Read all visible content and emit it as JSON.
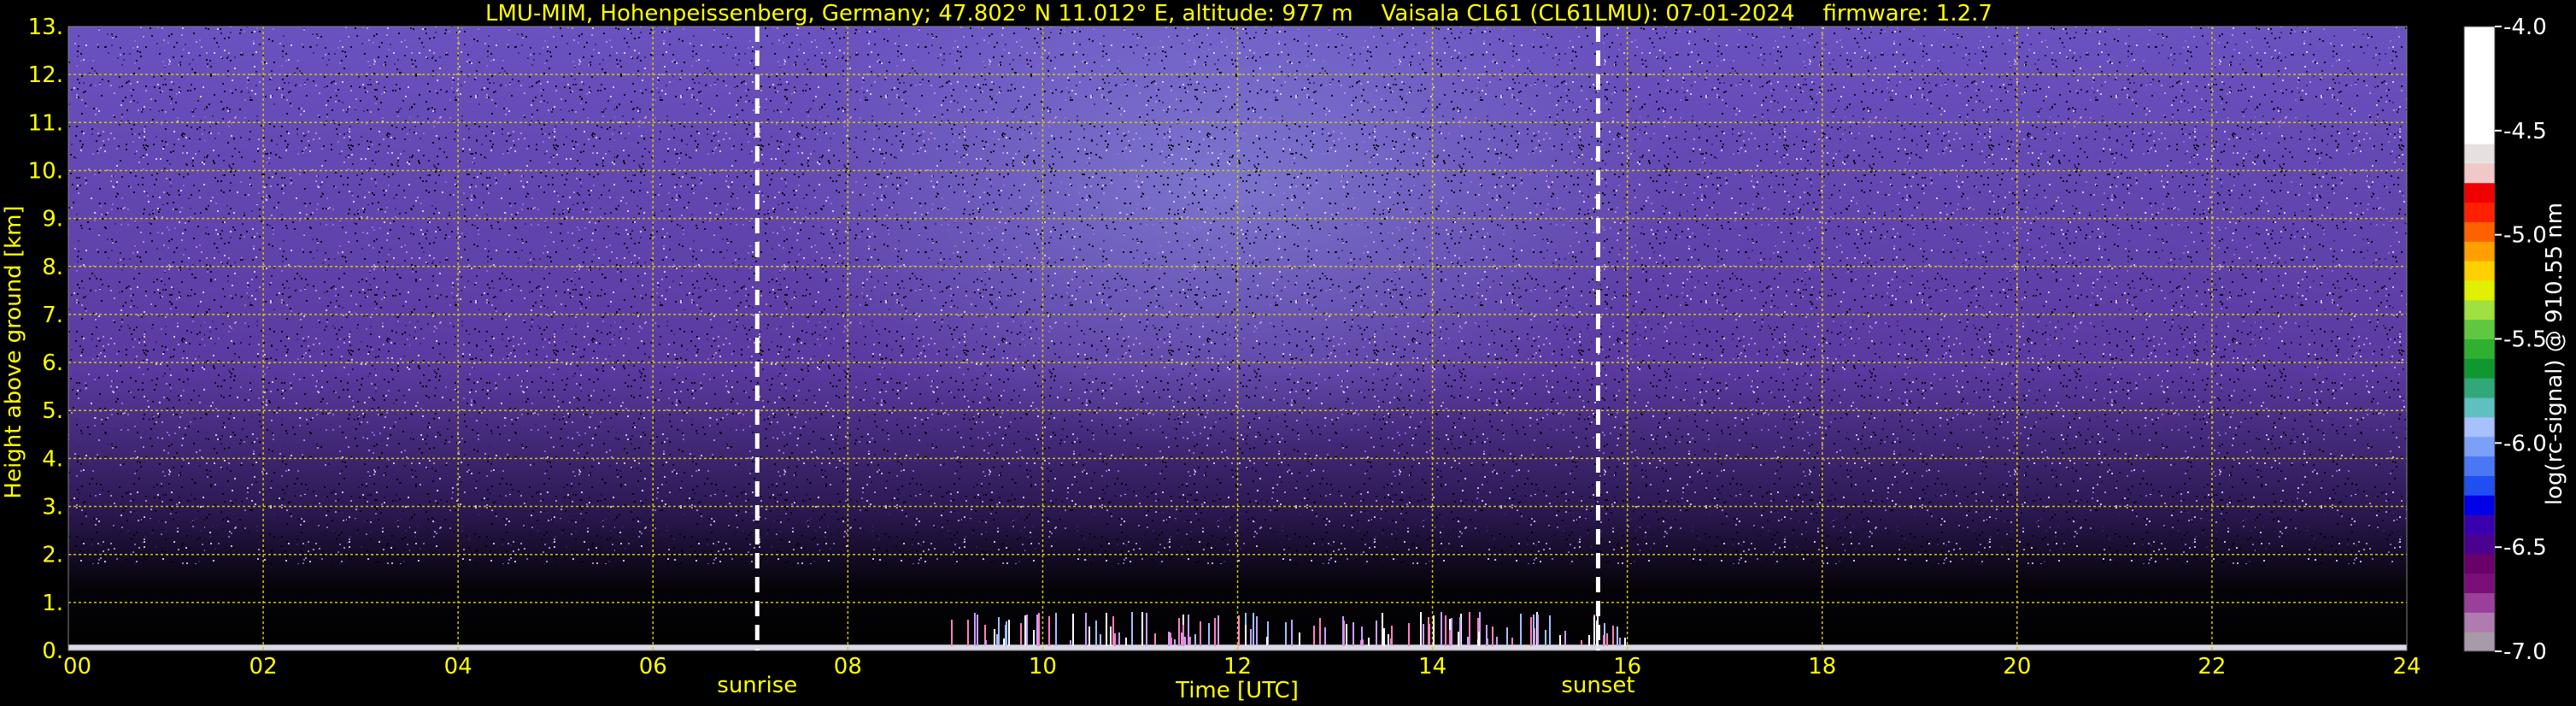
{
  "chart_data": {
    "type": "heatmap",
    "title": "LMU-MIM, Hohenpeissenberg, Germany; 47.802° N 11.012° E, altitude: 977 m    Vaisala CL61 (CL61LMU): 07-01-2024    firmware: 1.2.7",
    "xlabel": "Time [UTC]",
    "ylabel": "Height above ground [km]",
    "xlim": [
      0,
      24
    ],
    "ylim": [
      0,
      13
    ],
    "x_ticks": [
      "00",
      "02",
      "04",
      "06",
      "08",
      "10",
      "12",
      "14",
      "16",
      "18",
      "20",
      "22",
      "24"
    ],
    "y_ticks": [
      "0.",
      "1.",
      "2.",
      "3.",
      "4.",
      "5.",
      "6.",
      "7.",
      "8.",
      "9.",
      "10.",
      "11.",
      "12.",
      "13."
    ],
    "grid": true,
    "markers": [
      {
        "label": "sunrise",
        "x": 7.07
      },
      {
        "label": "sunset",
        "x": 15.7
      }
    ],
    "colorbar": {
      "label": "log(rc-signal) @ 910.55 nm",
      "range": [
        -7.0,
        -4.0
      ],
      "ticks": [
        "-4.0",
        "-4.5",
        "-5.0",
        "-5.5",
        "-6.0",
        "-6.5",
        "-7.0"
      ],
      "colors": [
        "#a89aa8",
        "#b07cb0",
        "#9a3f9a",
        "#7a0f7a",
        "#6a006a",
        "#4b0090",
        "#3a00b0",
        "#0000e8",
        "#1f4ff0",
        "#4a78f5",
        "#7aa0f8",
        "#a8c0fb",
        "#5fc0c0",
        "#30a878",
        "#109830",
        "#30b030",
        "#60c840",
        "#a0e040",
        "#e0f000",
        "#ffd000",
        "#ffa000",
        "#ff6000",
        "#ff2000",
        "#f00000",
        "#f0c8c8",
        "#e8e0e0",
        "#ffffff"
      ]
    },
    "colors": {
      "signal_low": "#6a3ea8",
      "signal_high": "#a8c8ff",
      "background": "#000000",
      "axis_text": "#ffff00",
      "grid": "#d4c800"
    }
  }
}
